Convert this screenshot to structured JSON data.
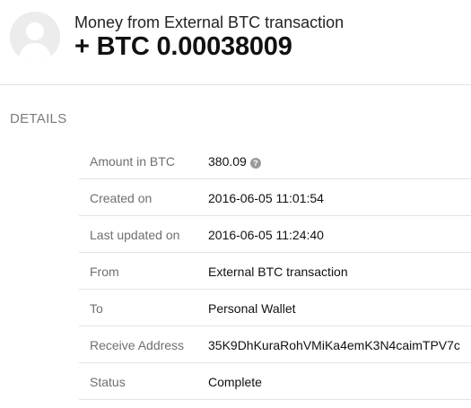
{
  "header": {
    "title": "Money from External BTC transaction",
    "amount": "+ BTC 0.00038009"
  },
  "details": {
    "section_title": "DETAILS",
    "rows": [
      {
        "label": "Amount in BTC",
        "value": "380.09"
      },
      {
        "label": "Created on",
        "value": "2016-06-05 11:01:54"
      },
      {
        "label": "Last updated on",
        "value": "2016-06-05 11:24:40"
      },
      {
        "label": "From",
        "value": "External BTC transaction"
      },
      {
        "label": "To",
        "value": "Personal Wallet"
      },
      {
        "label": "Receive Address",
        "value": "35K9DhKuraRohVMiKa4emK3N4caimTPV7c"
      },
      {
        "label": "Status",
        "value": "Complete"
      }
    ],
    "help_icon_glyph": "?"
  },
  "icons": {
    "avatar": "user-silhouette-icon",
    "help": "question-circle-icon"
  }
}
